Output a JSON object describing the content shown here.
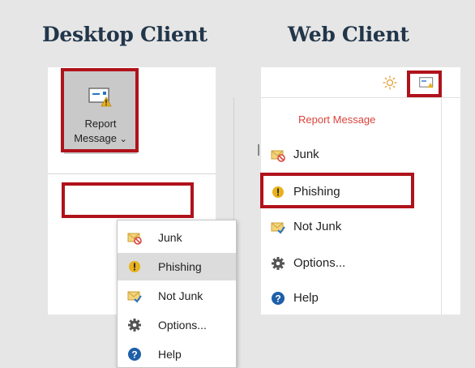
{
  "headings": {
    "desktop": "Desktop Client",
    "web": "Web Client"
  },
  "colors": {
    "highlight_border": "#b0121b",
    "web_report_label": "#d9443c",
    "heading": "#22364a",
    "phishing_icon": "#e8b21c",
    "help_icon": "#1e5fa8"
  },
  "desktop": {
    "report_button": {
      "line1": "Report",
      "line2": "Message",
      "chevron": "⌄",
      "icon": "report-message-icon"
    },
    "menu": [
      {
        "label": "Junk",
        "icon": "junk-icon"
      },
      {
        "label": "Phishing",
        "icon": "phishing-icon"
      },
      {
        "label": "Not Junk",
        "icon": "not-junk-icon"
      },
      {
        "label": "Options...",
        "icon": "gear-icon"
      },
      {
        "label": "Help",
        "icon": "help-icon"
      }
    ]
  },
  "web": {
    "toolbar_icons": [
      "sun-icon",
      "report-message-icon"
    ],
    "menu_title": "Report Message",
    "menu": [
      {
        "label": "Junk",
        "icon": "junk-icon"
      },
      {
        "label": "Phishing",
        "icon": "phishing-icon"
      },
      {
        "label": "Not Junk",
        "icon": "not-junk-icon"
      },
      {
        "label": "Options...",
        "icon": "gear-icon"
      },
      {
        "label": "Help",
        "icon": "help-icon"
      }
    ]
  }
}
